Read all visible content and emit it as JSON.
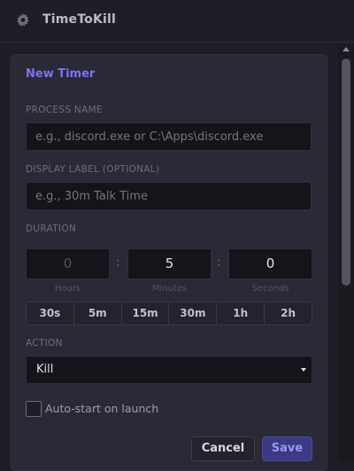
{
  "app": {
    "title": "TimeToKill",
    "settings_icon": "gear-icon"
  },
  "form": {
    "title": "New Timer",
    "process": {
      "label": "PROCESS NAME",
      "placeholder": "e.g., discord.exe or C:\\Apps\\discord.exe"
    },
    "display": {
      "label": "DISPLAY LABEL (OPTIONAL)",
      "placeholder": "e.g., 30m Talk Time"
    },
    "duration": {
      "label": "DURATION",
      "hours": "0",
      "minutes": "5",
      "seconds": "0",
      "hours_label": "Hours",
      "minutes_label": "Minutes",
      "seconds_label": "Seconds",
      "separator": ":"
    },
    "presets": [
      "30s",
      "5m",
      "15m",
      "30m",
      "1h",
      "2h"
    ],
    "action": {
      "label": "ACTION",
      "selected": "Kill"
    },
    "autostart": {
      "label": "Auto-start on launch",
      "checked": false
    },
    "buttons": {
      "cancel": "Cancel",
      "save": "Save"
    }
  },
  "colors": {
    "accent": "#7b73f0",
    "background": "#1f1e26",
    "card": "#2a2935",
    "input": "#15141a"
  }
}
